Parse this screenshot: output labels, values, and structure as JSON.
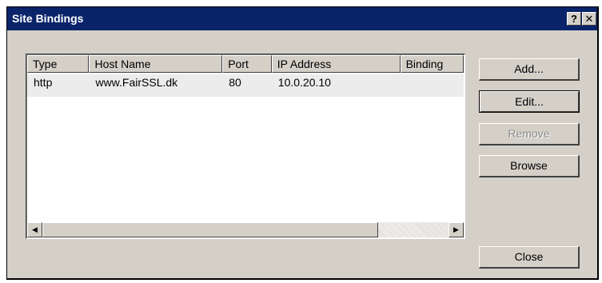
{
  "window": {
    "title": "Site Bindings",
    "help_label": "?",
    "close_label": "✕"
  },
  "list": {
    "columns": [
      "Type",
      "Host Name",
      "Port",
      "IP Address",
      "Binding"
    ],
    "rows": [
      [
        "http",
        "www.FairSSL.dk",
        "80",
        "10.0.20.10",
        ""
      ]
    ],
    "scroll_left_glyph": "◀",
    "scroll_right_glyph": "▶"
  },
  "buttons": {
    "add": "Add...",
    "edit": "Edit...",
    "remove": "Remove",
    "browse": "Browse",
    "close": "Close"
  }
}
